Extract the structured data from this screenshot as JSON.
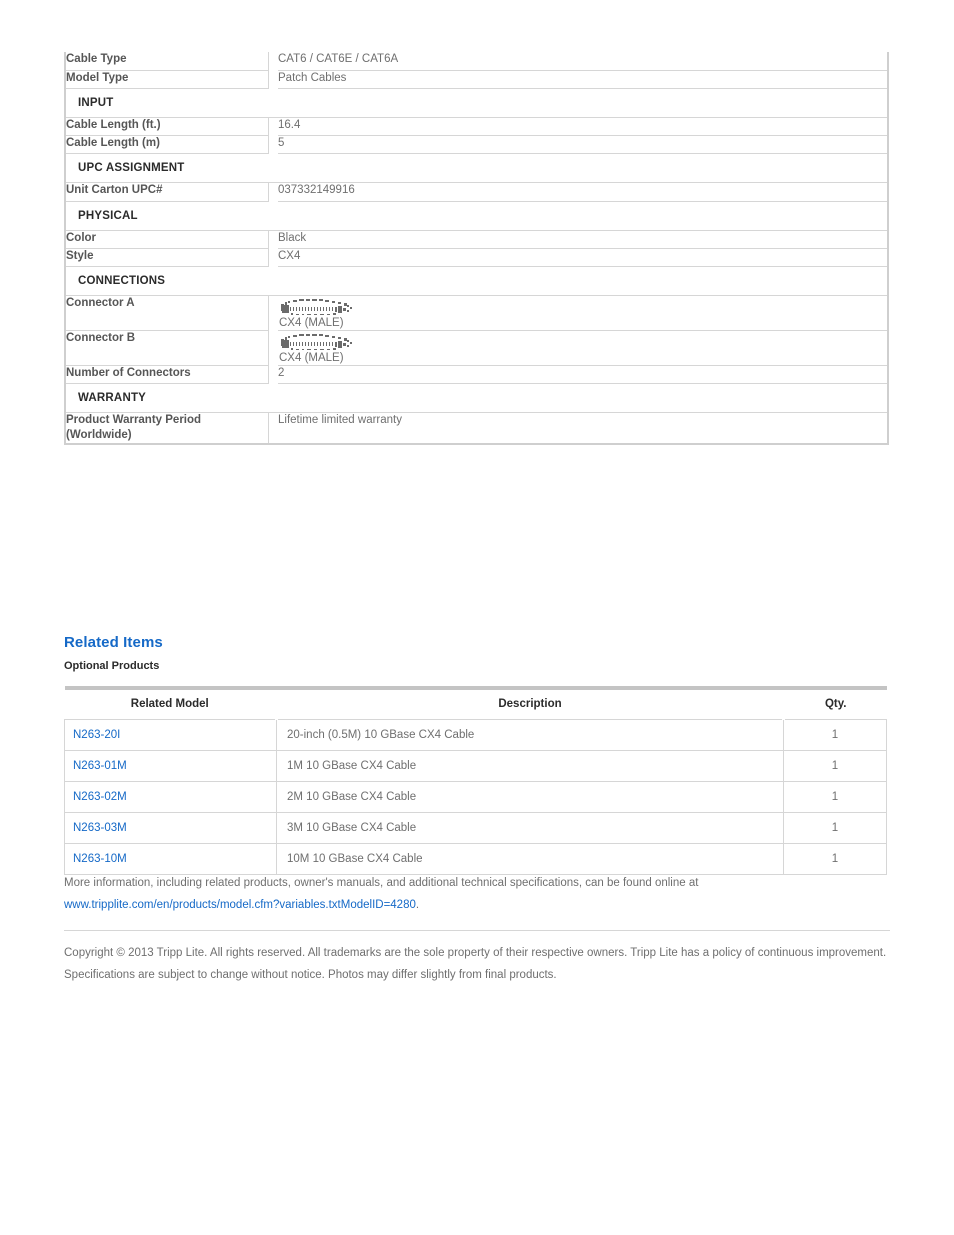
{
  "spec_table": {
    "rows": [
      {
        "kind": "row",
        "label": "Cable Type",
        "value": "CAT6 / CAT6E / CAT6A"
      },
      {
        "kind": "row",
        "label": "Model Type",
        "value": "Patch Cables"
      },
      {
        "kind": "section",
        "label": "INPUT"
      },
      {
        "kind": "row",
        "label": "Cable Length (ft.)",
        "value": "16.4"
      },
      {
        "kind": "row",
        "label": "Cable Length (m)",
        "value": "5"
      },
      {
        "kind": "section",
        "label": "UPC ASSIGNMENT"
      },
      {
        "kind": "row",
        "label": "Unit Carton UPC#",
        "value": "037332149916"
      },
      {
        "kind": "section",
        "label": "PHYSICAL"
      },
      {
        "kind": "row",
        "label": "Color",
        "value": "Black"
      },
      {
        "kind": "row",
        "label": "Style",
        "value": "CX4"
      },
      {
        "kind": "section",
        "label": "CONNECTIONS"
      },
      {
        "kind": "connector",
        "label": "Connector A",
        "value": "CX4 (MALE)"
      },
      {
        "kind": "connector",
        "label": "Connector B",
        "value": "CX4 (MALE)"
      },
      {
        "kind": "row",
        "label": "Number of Connectors",
        "value": "2"
      },
      {
        "kind": "section",
        "label": "WARRANTY"
      },
      {
        "kind": "row",
        "label": "Product Warranty Period (Worldwide)",
        "value": "Lifetime limited warranty"
      }
    ]
  },
  "related": {
    "heading": "Related Items",
    "subheading": "Optional Products",
    "columns": [
      "Related Model",
      "Description",
      "Qty."
    ],
    "rows": [
      {
        "model": "N263-20I",
        "description": "20-inch (0.5M) 10 GBase CX4 Cable",
        "qty": "1"
      },
      {
        "model": "N263-01M",
        "description": "1M 10 GBase CX4 Cable",
        "qty": "1"
      },
      {
        "model": "N263-02M",
        "description": "2M 10 GBase CX4 Cable",
        "qty": "1"
      },
      {
        "model": "N263-03M",
        "description": "3M 10 GBase CX4 Cable",
        "qty": "1"
      },
      {
        "model": "N263-10M",
        "description": "10M 10 GBase CX4 Cable",
        "qty": "1"
      }
    ]
  },
  "footer": {
    "more_info_text": "More information, including related products, owner's manuals, and additional technical specifications, can be found online at ",
    "url_text": "www.tripplite.com/en/products/model.cfm?variables.txtModelID=4280",
    "url_trailing": ".",
    "copyright": "Copyright © 2013 Tripp Lite. All rights reserved. All trademarks are the sole property of their respective owners. Tripp Lite has a policy of continuous improvement. Specifications are subject to change without notice. Photos may differ slightly from final products."
  },
  "colors": {
    "link_blue": "#1569c7",
    "label_gray": "#565656",
    "value_gray": "#6f6f6f",
    "border_gray": "#d6d6d6"
  }
}
